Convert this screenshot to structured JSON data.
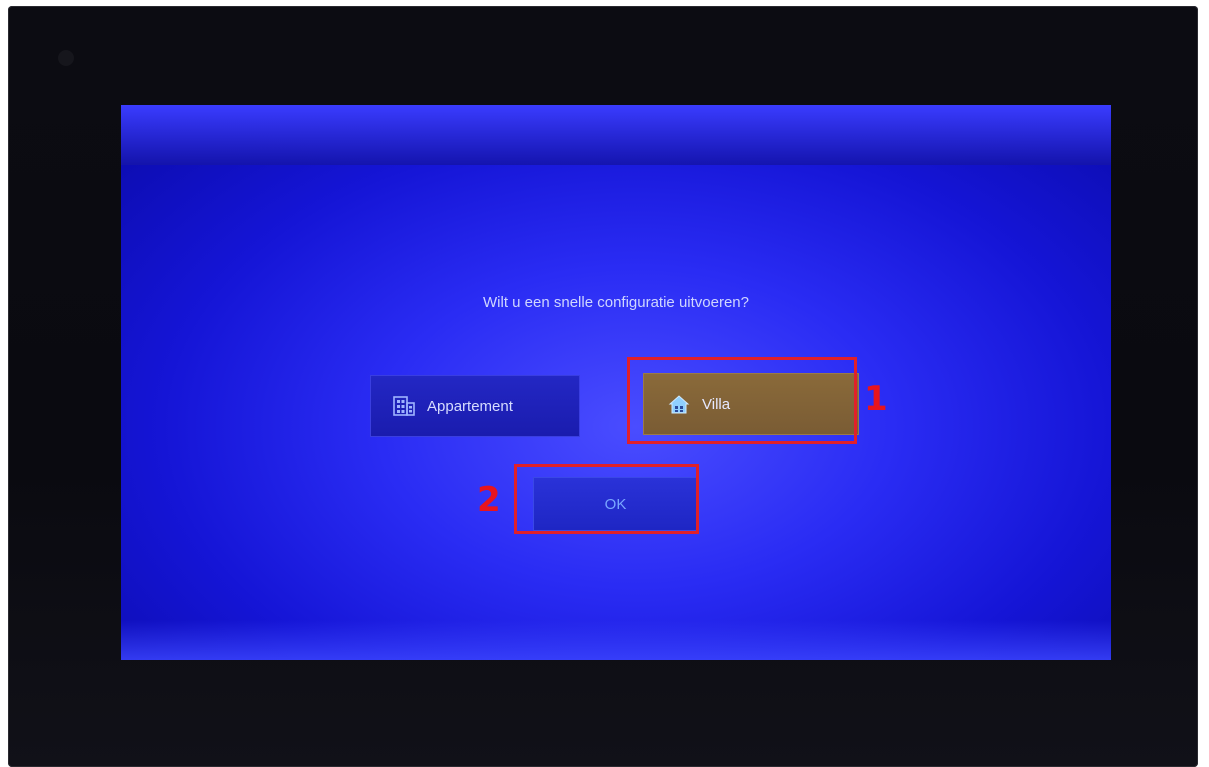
{
  "screen": {
    "prompt": "Wilt u een snelle configuratie uitvoeren?"
  },
  "options": [
    {
      "label": "Appartement",
      "icon": "apartment-building-icon",
      "selected": false
    },
    {
      "label": "Villa",
      "icon": "house-icon",
      "selected": true
    }
  ],
  "ok_button": {
    "label": "OK"
  },
  "annotations": [
    {
      "number": "1"
    },
    {
      "number": "2"
    }
  ],
  "colors": {
    "screen_blue": "#2a2cf4",
    "selected_option": "#8a6a3a",
    "annotation_red": "#e0202a"
  }
}
